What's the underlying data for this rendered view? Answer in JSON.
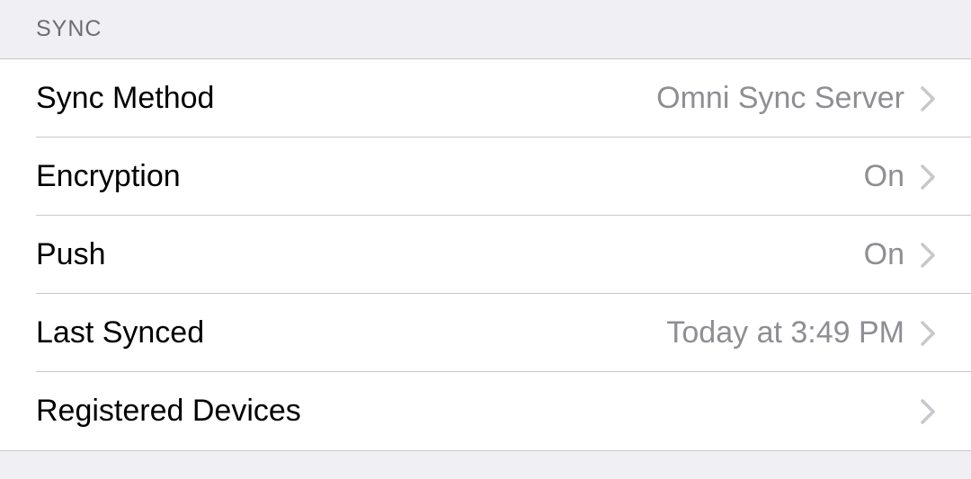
{
  "section": {
    "title": "SYNC",
    "rows": [
      {
        "label": "Sync Method",
        "value": "Omni Sync Server"
      },
      {
        "label": "Encryption",
        "value": "On"
      },
      {
        "label": "Push",
        "value": "On"
      },
      {
        "label": "Last Synced",
        "value": "Today at 3:49 PM"
      },
      {
        "label": "Registered Devices",
        "value": ""
      }
    ]
  }
}
